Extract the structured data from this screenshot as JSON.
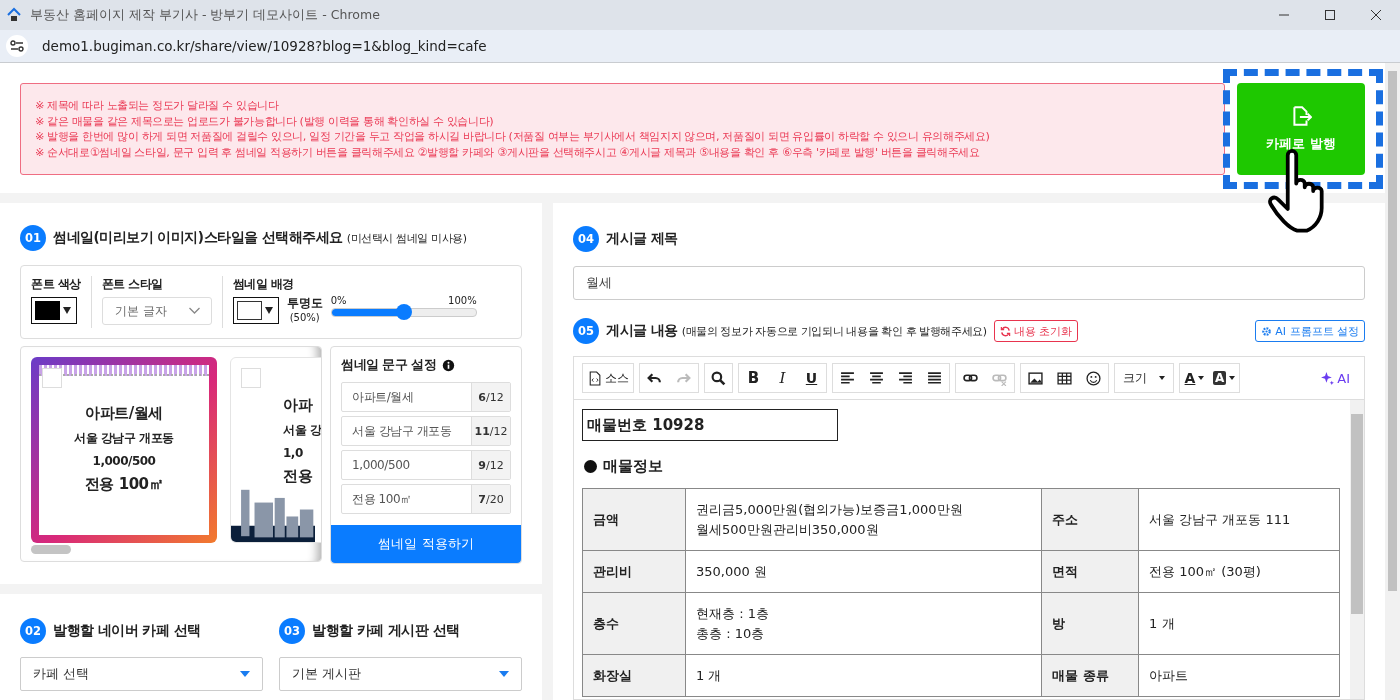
{
  "window": {
    "title": "부동산 홈페이지 제작 부기사 - 방부기 데모사이트 - Chrome",
    "url": "demo1.bugiman.co.kr/share/view/10928?blog=1&blog_kind=cafe"
  },
  "notice": {
    "lines": [
      "※ 제목에 따라 노출되는 정도가 달라질 수 있습니다",
      "※ 같은 매물을 같은 제목으로는 업로드가 불가능합니다 (발행 이력을 통해 확인하실 수 있습니다)",
      "※ 발행을 한번에 많이 하게 되면 저품질에 걸릴수 있으니, 일정 기간을 두고 작업을 하시길 바랍니다 (저품질 여부는 부기사에서 책임지지 않으며, 저품질이 되면 유입률이 하락할 수 있으니 유의해주세요)",
      "※ 순서대로①썸네일 스타일, 문구 입력 후 썸네일 적용하기 버튼을 클릭해주세요 ②발행할 카페와 ③게시판을 선택해주시고 ④게시글 제목과 ⑤내용을 확인 후 ⑥우측 '카페로 발행' 버튼을 클릭해주세요"
    ]
  },
  "publish_button": {
    "label": "카페로 발행"
  },
  "thumbnail_style": {
    "step": "01",
    "title": "썸네일(미리보기 이미지)스타일을 선택해주세요",
    "hint": "(미선택시 썸네일 미사용)",
    "font_color": {
      "label": "폰트 색상",
      "color": "#000000"
    },
    "font_style": {
      "label": "폰트 스타일",
      "value": "기본 글자"
    },
    "background": {
      "label": "썸네일 배경",
      "color": "#ffffff"
    },
    "opacity": {
      "label": "투명도",
      "reading": "(50%)",
      "min": "0%",
      "max": "100%",
      "level": 0.5
    },
    "cards": [
      {
        "kind": "gradient",
        "checked": false,
        "lines": [
          "아파트/월세",
          "서울 강남구 개포동",
          "1,000/500",
          "전용 100㎡"
        ]
      },
      {
        "kind": "city",
        "checked": false,
        "lines": [
          "아파",
          "서울 강",
          "1,0",
          "전용"
        ]
      }
    ],
    "text_settings": {
      "title": "썸네일 문구 설정",
      "fields": [
        {
          "value": "아파트/월세",
          "count": "**6**/12"
        },
        {
          "value": "서울 강남구 개포동",
          "count": "**11**/12"
        },
        {
          "value": "1,000/500",
          "count": "**9**/12"
        },
        {
          "value": "전용 100㎡",
          "count": "**7**/20"
        }
      ],
      "apply_button": "썸네일 적용하기"
    }
  },
  "cafe": {
    "step": "02",
    "title": "발행할 네이버 카페 선택",
    "value": "카페 선택"
  },
  "board": {
    "step": "03",
    "title": "발행할 카페 게시판 선택",
    "value": "기본 게시판"
  },
  "post_title": {
    "step": "04",
    "title": "게시글 제목",
    "value": "월세"
  },
  "post_content": {
    "step": "05",
    "title": "게시글 내용",
    "hint": "(매물의 정보가 자동으로 기입되니 내용을 확인 후 발행해주세요)",
    "reset_button": "내용 초기화",
    "ai_button": "AI 프롬프트 설정",
    "toolbar": [
      [
        {
          "kind": "source",
          "label": "소스",
          "disabled": false
        }
      ],
      [
        {
          "kind": "undo",
          "disabled": false
        },
        {
          "kind": "redo",
          "disabled": true
        }
      ],
      [
        {
          "kind": "search",
          "disabled": false
        }
      ],
      [
        {
          "kind": "bold",
          "label": "B",
          "disabled": false
        },
        {
          "kind": "italic",
          "label": "I",
          "disabled": false
        },
        {
          "kind": "underline",
          "label": "U",
          "disabled": false
        }
      ],
      [
        {
          "kind": "align-left",
          "disabled": false
        },
        {
          "kind": "align-center",
          "disabled": false
        },
        {
          "kind": "align-right",
          "disabled": false
        },
        {
          "kind": "align-justify",
          "disabled": false
        }
      ],
      [
        {
          "kind": "link",
          "disabled": false
        },
        {
          "kind": "unlink",
          "disabled": true
        }
      ],
      [
        {
          "kind": "image",
          "disabled": false
        },
        {
          "kind": "table",
          "disabled": false
        },
        {
          "kind": "emoji",
          "disabled": false
        }
      ],
      [
        {
          "kind": "size",
          "label": "크기",
          "disabled": false
        }
      ],
      [
        {
          "kind": "font-color",
          "label": "A",
          "disabled": false
        },
        {
          "kind": "bg-color",
          "label": "A",
          "disabled": false
        }
      ]
    ],
    "ai_label": "AI",
    "editor": {
      "property_number": "매물번호 10928",
      "section": "매물정보",
      "rows": [
        {
          "label": "금액",
          "value": "권리금5,000만원(협의가능)보증금1,000만원\n월세500만원관리비350,000원",
          "label2": "주소",
          "value2": "서울 강남구 개포동 111"
        },
        {
          "label": "관리비",
          "value": "350,000 원",
          "label2": "면적",
          "value2": "전용 100㎡ (30평)"
        },
        {
          "label": "층수",
          "value": "현재층 : 1층\n총층 : 10층",
          "label2": "방",
          "value2": "1 개"
        },
        {
          "label": "화장실",
          "value": "1 개",
          "label2": "매물 종류",
          "value2": "아파트"
        }
      ]
    }
  }
}
